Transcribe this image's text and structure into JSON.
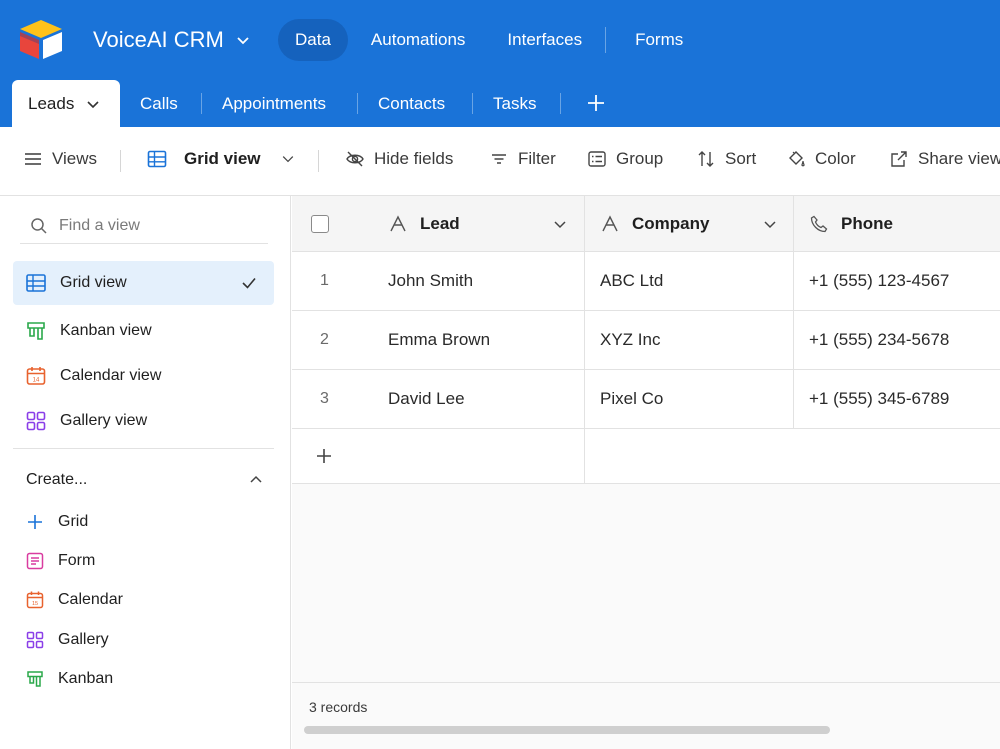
{
  "app": {
    "title": "VoiceAI CRM"
  },
  "topnav": {
    "items": [
      "Data",
      "Automations",
      "Interfaces",
      "Forms"
    ],
    "active": "Data"
  },
  "tabs": {
    "items": [
      "Leads",
      "Calls",
      "Appointments",
      "Contacts",
      "Tasks"
    ],
    "active": "Leads"
  },
  "toolbar": {
    "views": "Views",
    "current_view": "Grid view",
    "hide_fields": "Hide fields",
    "filter": "Filter",
    "group": "Group",
    "sort": "Sort",
    "color": "Color",
    "share": "Share view"
  },
  "sidebar": {
    "search_placeholder": "Find a view",
    "views": [
      {
        "label": "Grid view",
        "icon": "grid-icon",
        "active": true
      },
      {
        "label": "Kanban view",
        "icon": "kanban-icon"
      },
      {
        "label": "Calendar view",
        "icon": "calendar-icon"
      },
      {
        "label": "Gallery view",
        "icon": "gallery-icon"
      }
    ],
    "create_label": "Create...",
    "create_items": [
      {
        "label": "Grid",
        "icon": "plus-icon"
      },
      {
        "label": "Form",
        "icon": "form-icon"
      },
      {
        "label": "Calendar",
        "icon": "calendar-icon"
      },
      {
        "label": "Gallery",
        "icon": "gallery-icon"
      },
      {
        "label": "Kanban",
        "icon": "kanban-icon"
      }
    ]
  },
  "grid": {
    "columns": [
      "Lead",
      "Company",
      "Phone"
    ],
    "rows": [
      {
        "num": "1",
        "lead": "John Smith",
        "company": "ABC Ltd",
        "phone": "+1 (555) 123-4567"
      },
      {
        "num": "2",
        "lead": "Emma Brown",
        "company": "XYZ Inc",
        "phone": "+1 (555) 234-5678"
      },
      {
        "num": "3",
        "lead": "David Lee",
        "company": "Pixel Co",
        "phone": "+1 (555) 345-6789"
      }
    ],
    "record_count": "3 records"
  },
  "colors": {
    "brand": "#1a73d8",
    "active_nav": "#1562bd",
    "selected_view": "#e4f0fc"
  }
}
